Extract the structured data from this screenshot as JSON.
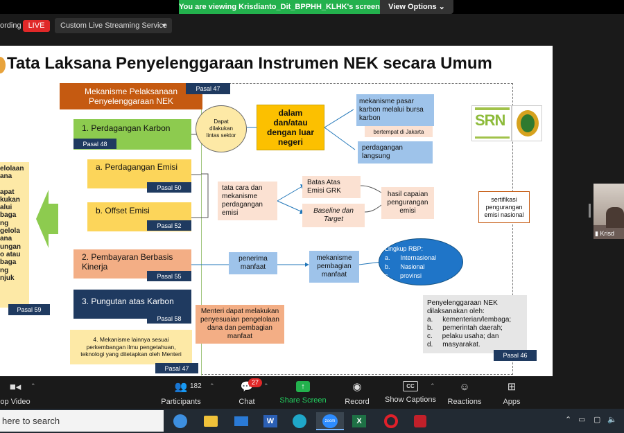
{
  "zoom": {
    "viewing_banner": "You are viewing Krisdianto_Dit_BPPHH_KLHK's screen",
    "view_options": "View Options",
    "recording_text": "ording",
    "live_badge": "LIVE",
    "stream_service": "Custom Live Streaming Service",
    "participant_name": "Krisd",
    "toolbar": {
      "video": "op Video",
      "participants": "Participants",
      "participants_count": "182",
      "chat": "Chat",
      "chat_badge": "27",
      "share_screen": "Share Screen",
      "record": "Record",
      "captions": "Show Captions",
      "reactions": "Reactions",
      "apps": "Apps"
    }
  },
  "taskbar": {
    "search_placeholder": "here to search"
  },
  "slide": {
    "title": "Tata Laksana Penyelenggaraan Instrumen NEK secara Umum",
    "header_box": "Mekanisme Pelaksanaan Penyelenggaraan NEK",
    "pasal_47_top": "Pasal 47",
    "item1": "1. Perdagangan Karbon",
    "pasal_48": "Pasal 48",
    "item_a": "a.    Perdagangan Emisi",
    "pasal_50": "Pasal 50",
    "item_b": "b. Offset Emisi",
    "pasal_52": "Pasal 52",
    "item2": "2. Pembayaran Berbasis Kinerja",
    "pasal_55": "Pasal 55",
    "item3": "3. Pungutan atas Karbon",
    "pasal_58": "Pasal 58",
    "item4": "4.  Mekanisme lainnya sesuai perkembangan  ilmu pengetahuan, teknologi yang ditetapkan oleh Menteri",
    "pasal_47_bottom": "Pasal 47",
    "lintas_sektor": "Dapat dilakukan lintas sektor",
    "dalam_negeri": "dalam dan/atau dengan luar negeri",
    "pasar_karbon": "mekanisme pasar karbon melalui bursa karbon",
    "jakarta": "bertempat di Jakarta",
    "perdagangan_langsung": "perdagangan langsung",
    "tata_cara": "tata cara dan mekanisme perdagangan emisi",
    "batas_atas": "Batas Atas Emisi GRK",
    "baseline": "Baseline dan Target",
    "hasil_capaian": "hasil capaian pengurangan emisi",
    "sertifikasi": "sertifikasi pengurangan emisi nasional",
    "penerima": "penerima manfaat",
    "pembagian": "mekanisme pembagian manfaat",
    "lingkup_title": "Lingkup RBP:",
    "lingkup_items": [
      "a.      Internasional",
      "b.      Nasional",
      "c.      provinsi"
    ],
    "menteri": "Menteri dapat melakukan penyesuaian pengelolaan dana dan pembagian manfaat",
    "penyelenggara_title": "Penyelenggaraan NEK dilaksanakan oleh:",
    "penyelenggara_items": [
      "a.     kementerian/lembaga;",
      "b.     pemerintah daerah;",
      "c.     pelaku usaha; dan",
      "d.     masyarakat."
    ],
    "pasal_46": "Pasal 46",
    "left_box_lines": [
      "elolaan",
      "ana",
      "",
      "apat",
      "kukan",
      "alui",
      "baga",
      "ng",
      "gelola",
      "ana",
      "ungan",
      "o atau",
      "baga",
      "ng",
      "njuk"
    ],
    "pasal_59": "Pasal 59",
    "logo_text": "SRN"
  },
  "colors": {
    "live_red": "#e02828",
    "banner_green": "#23b14d",
    "green_box": "#8dcb4f",
    "yellow_box": "#fcd55a",
    "orange_box": "#f3ae85",
    "navy_box": "#1f3a60",
    "blue_box": "#9ec3ea",
    "peach_box": "#fbe1d2"
  }
}
